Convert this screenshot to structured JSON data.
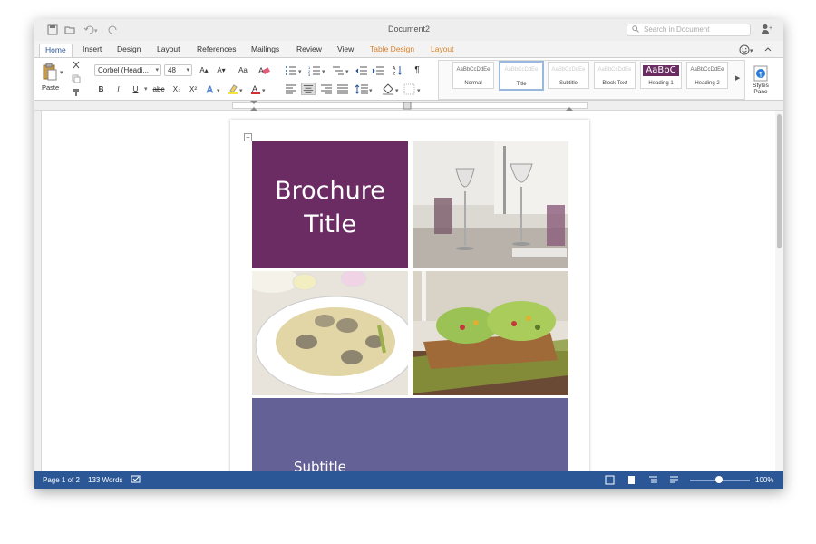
{
  "window": {
    "title": "Document2"
  },
  "search": {
    "placeholder": "Search in Document"
  },
  "tabs": [
    {
      "label": "Home"
    },
    {
      "label": "Insert"
    },
    {
      "label": "Design"
    },
    {
      "label": "Layout"
    },
    {
      "label": "References"
    },
    {
      "label": "Mailings"
    },
    {
      "label": "Review"
    },
    {
      "label": "View"
    },
    {
      "label": "Table Design"
    },
    {
      "label": "Layout"
    }
  ],
  "ribbon": {
    "paste_label": "Paste",
    "font_name": "Corbel (Headi...",
    "font_size": "48",
    "bold": "B",
    "italic": "I",
    "underline": "U",
    "strike": "abc",
    "subscript": "X₂",
    "superscript": "X²",
    "grow_font": "A▴",
    "shrink_font": "A▾",
    "change_case": "Aa",
    "styles": [
      {
        "preview": "AaBbCcDdEe",
        "label": "Normal"
      },
      {
        "preview": "AaBbCcDdEe",
        "label": "Title"
      },
      {
        "preview": "AaBbCcDdEe",
        "label": "Subtitle"
      },
      {
        "preview": "AaBbCcDdEe",
        "label": "Block Text"
      },
      {
        "preview": "AaBbC",
        "label": "Heading 1"
      },
      {
        "preview": "AaBbCcDdEe",
        "label": "Heading 2"
      }
    ],
    "styles_pane_label": "Styles Pane"
  },
  "document": {
    "title_cell_text": "Brochure Title",
    "subtitle_text": "Subtitle",
    "photos": [
      {
        "icon": "wine-glasses-photo"
      },
      {
        "icon": "clam-pasta-photo"
      },
      {
        "icon": "lettuce-wraps-photo"
      }
    ]
  },
  "status": {
    "page": "Page 1 of 2",
    "words": "133 Words",
    "zoom": "100%",
    "zoom_value": 1.0
  },
  "colors": {
    "accent": "#2b5797",
    "title_cell": "#6b2c63",
    "subtitle_cell": "#646197",
    "context_tab": "#d9822b"
  }
}
